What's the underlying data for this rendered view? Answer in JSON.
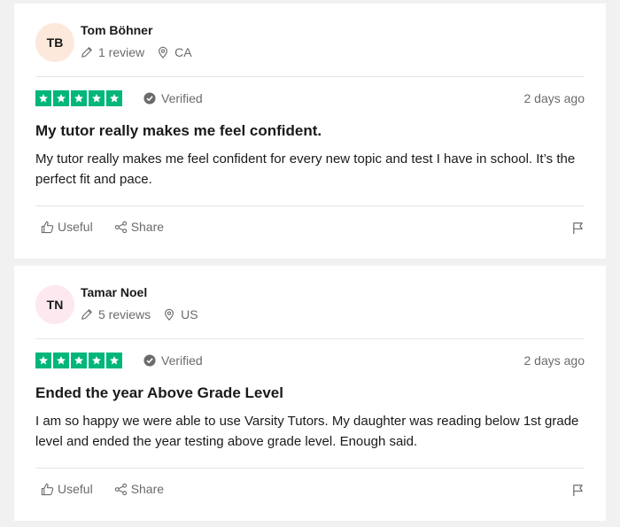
{
  "reviews": [
    {
      "initials": "TB",
      "avatar_color": "#fde8dc",
      "name": "Tom Böhner",
      "review_count": "1 review",
      "location": "CA",
      "verified_label": "Verified",
      "date": "2 days ago",
      "rating": 5,
      "title": "My tutor really makes me feel confident.",
      "body": "My tutor really makes me feel confident for every new topic and test I have in school. It’s the perfect fit and pace.",
      "useful_label": "Useful",
      "share_label": "Share"
    },
    {
      "initials": "TN",
      "avatar_color": "#fde8ef",
      "name": "Tamar Noel",
      "review_count": "5 reviews",
      "location": "US",
      "verified_label": "Verified",
      "date": "2 days ago",
      "rating": 5,
      "title": "Ended the year Above Grade Level",
      "body": "I am so happy we were able to use Varsity Tutors. My daughter was reading below 1st grade level and ended the year testing above grade level. Enough said.",
      "useful_label": "Useful",
      "share_label": "Share"
    }
  ],
  "colors": {
    "star_green": "#00b67a",
    "muted_text": "#6b6b6b"
  }
}
